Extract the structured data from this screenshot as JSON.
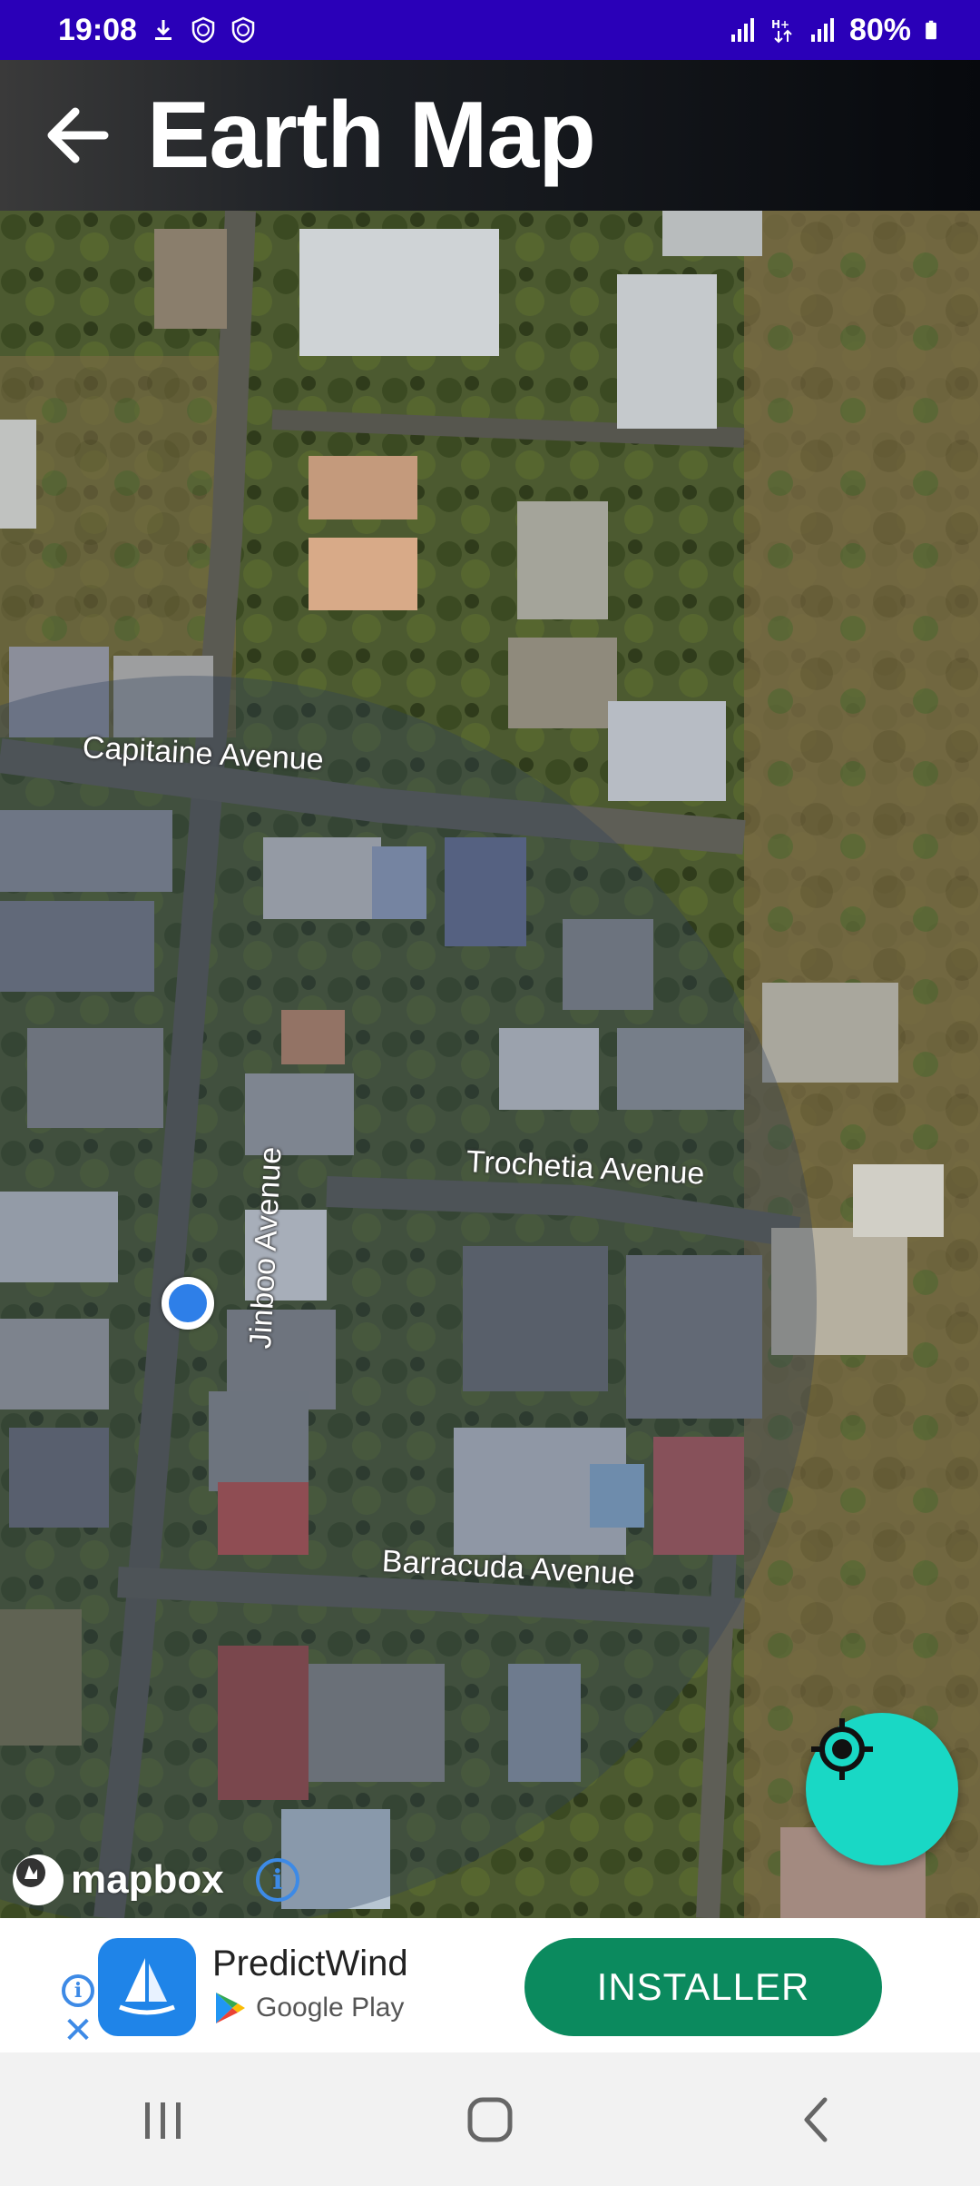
{
  "status_bar": {
    "time": "19:08",
    "battery": "80%",
    "icons": [
      "download-icon",
      "shield-clock-icon",
      "shield-clock-icon",
      "signal-icon",
      "data-icon",
      "signal-icon",
      "battery-icon"
    ]
  },
  "app_bar": {
    "title": "Earth Map",
    "back_icon": "arrow-left-icon"
  },
  "map": {
    "street_labels": {
      "capitaine": "Capitaine Avenue",
      "trochetia": "Trochetia Avenue",
      "jinboo": "Jinboo Avenue",
      "barracuda": "Barracuda Avenue"
    },
    "attribution_logo": "mapbox",
    "attribution_icon": "info-icon",
    "locate_icon": "crosshair-icon",
    "colors": {
      "location_dot": "#2e7fe8",
      "locate_button": "#19d8c5"
    }
  },
  "ad": {
    "app_name": "PredictWind",
    "store": "Google Play",
    "cta": "INSTALLER",
    "colors": {
      "cta": "#0b8a5e",
      "app_icon": "#1f84e8"
    }
  },
  "nav_bar": {
    "buttons": [
      "recents-icon",
      "home-icon",
      "back-icon"
    ]
  }
}
